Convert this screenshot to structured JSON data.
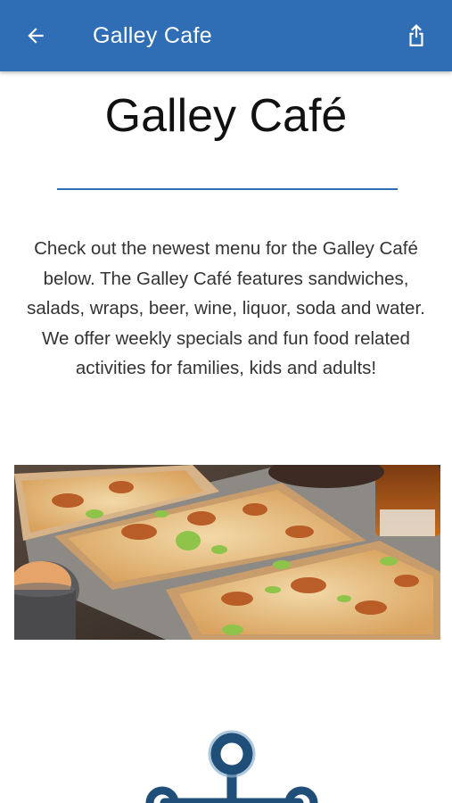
{
  "appbar": {
    "title": "Galley Cafe",
    "back_icon": "arrow-left-icon",
    "share_icon": "share-icon",
    "color": "#2f6db5"
  },
  "main": {
    "heading": "Galley Café",
    "intro": "Check out the newest menu for the Galley Café below. The Galley Café features sandwiches, salads, wraps, beer, wine, liquor, soda and water. We offer weekly specials and fun food related activities for families, kids and adults!",
    "rule_color": "#2f6db5"
  },
  "image": {
    "subject": "flatbread pizzas with chicken and celery",
    "logo_icon": "ship-wheel-logo-icon"
  }
}
